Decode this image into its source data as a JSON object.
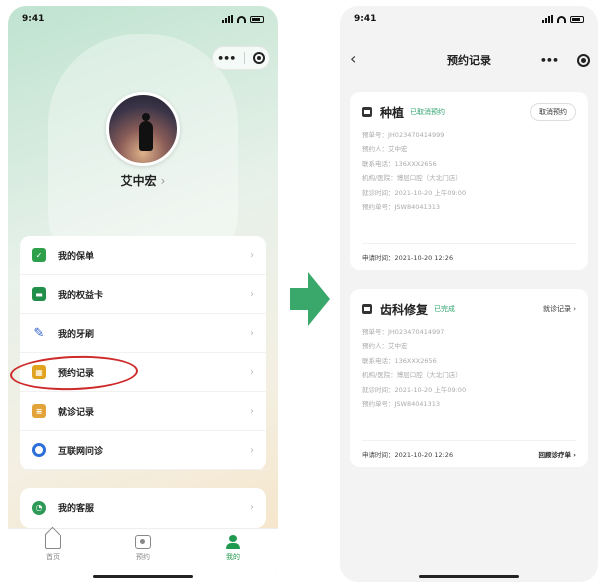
{
  "left": {
    "status_time": "9:41",
    "username": "艾中宏",
    "menu": [
      {
        "label": "我的保单",
        "icon": "shield-icon"
      },
      {
        "label": "我的权益卡",
        "icon": "card-icon"
      },
      {
        "label": "我的牙刷",
        "icon": "toothbrush-icon"
      },
      {
        "label": "预约记录",
        "icon": "calendar-icon"
      },
      {
        "label": "就诊记录",
        "icon": "document-icon"
      },
      {
        "label": "互联网问诊",
        "icon": "chat-icon"
      }
    ],
    "menu2": [
      {
        "label": "我的客服",
        "icon": "service-icon"
      }
    ],
    "tabs": [
      {
        "label": "首页",
        "icon": "home-icon"
      },
      {
        "label": "预约",
        "icon": "book-icon"
      },
      {
        "label": "我的",
        "icon": "user-icon",
        "active": true
      }
    ],
    "highlight_color": "#cf2a2a",
    "accent_color": "#1f9a4e"
  },
  "right": {
    "status_time": "9:41",
    "page_title": "预约记录",
    "appointments": [
      {
        "title": "种植",
        "status": "已取消预约",
        "action": "取消预约",
        "fields": [
          "预单号：JH023470414999",
          "预约人：艾中宏",
          "联系电话：136XXX2656",
          "机构/医院：博层口腔（大北门店）",
          "就诊时间：2021-10-20 上午09:00",
          "预约单号：JSW84041313"
        ],
        "footer_label": "申请时间：2021-10-20 12:26",
        "footer_link": ""
      },
      {
        "title": "齿科修复",
        "status": "已完成",
        "action": "就诊记录 ›",
        "fields": [
          "预单号：JH023470414997",
          "预约人：艾中宏",
          "联系电话：136XXX2656",
          "机构/医院：博层口腔（大北门店）",
          "就诊时间：2021-10-20 上午09:00",
          "预约单号：JSW84041313"
        ],
        "footer_label": "申请时间：2021-10-20 12:26",
        "footer_link": "回顾诊疗单 ›"
      }
    ]
  },
  "arrow_color": "#3aa86a"
}
